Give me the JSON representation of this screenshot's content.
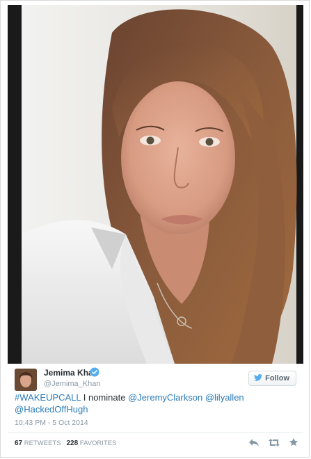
{
  "tweet": {
    "author_name": "Jemima Khan",
    "author_handle": "@Jemima_Khan",
    "follow_label": "Follow",
    "text_parts": {
      "hashtag": "#WAKEUPCALL",
      "middle": " I nominate ",
      "mention1": "@JeremyClarkson",
      "mention2": "@lilyallen",
      "mention3": "@HackedOffHugh"
    },
    "timestamp": "10:43 PM - 5 Oct 2014",
    "retweets_count": "67",
    "retweets_label": "RETWEETS",
    "favorites_count": "228",
    "favorites_label": "FAVORITES"
  },
  "colors": {
    "link": "#2b7bb9",
    "verified": "#55acee",
    "muted": "#8899a6"
  },
  "icons": [
    "verified-badge-icon",
    "twitter-bird-icon",
    "reply-icon",
    "retweet-icon",
    "favorite-star-icon"
  ]
}
